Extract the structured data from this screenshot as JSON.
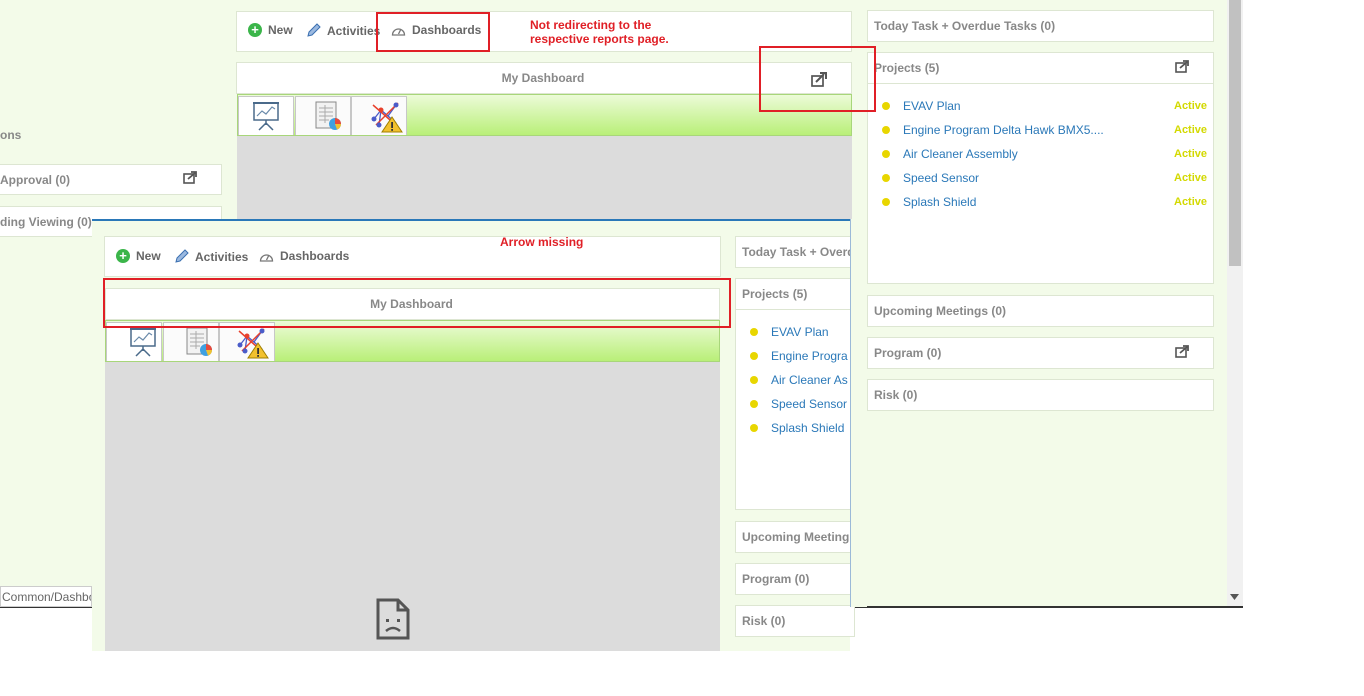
{
  "toolbar": {
    "new_label": "New",
    "activities_label": "Activities",
    "dashboards_label": "Dashboards"
  },
  "dashboard": {
    "title": "My Dashboard"
  },
  "annotations": {
    "redirect_note_line1": "Not redirecting to the",
    "redirect_note_line2": "respective reports page.",
    "arrow_note": "Arrow missing"
  },
  "right_panel": {
    "today_tasks": "Today Task + Overdue Tasks (0)",
    "projects_title": "Projects (5)",
    "projects": [
      {
        "name": "EVAV Plan",
        "status": "Active"
      },
      {
        "name": "Engine Program Delta Hawk BMX5....",
        "status": "Active"
      },
      {
        "name": "Air Cleaner Assembly",
        "status": "Active"
      },
      {
        "name": "Speed Sensor",
        "status": "Active"
      },
      {
        "name": "Splash Shield",
        "status": "Active"
      }
    ],
    "upcoming_meetings": "Upcoming Meetings (0)",
    "program": "Program (0)",
    "risk": "Risk (0)"
  },
  "left_panel": {
    "section_fragment": "ons",
    "approval": "Approval (0)",
    "pending_viewing": "ding Viewing (0)",
    "url_fragment": "Common/Dashbo"
  },
  "inset": {
    "today_tasks_partial": "Today Task + Overd",
    "projects_title": "Projects (5)",
    "projects": [
      "EVAV Plan",
      "Engine Progra",
      "Air Cleaner As",
      "Speed Sensor",
      "Splash Shield"
    ],
    "upcoming_partial": "Upcoming Meeting",
    "program": "Program (0)",
    "risk": "Risk (0)"
  },
  "colors": {
    "accent_green": "#3bb54a",
    "annotation_red": "#e01f26",
    "link_blue": "#2a78b8",
    "status_yellow": "#d3d900"
  },
  "icons": [
    "plus-circle-icon",
    "pencil-icon",
    "speedometer-icon",
    "export-icon",
    "presentation-chart-icon",
    "spreadsheet-pie-icon",
    "network-warning-icon",
    "broken-file-icon",
    "scroll-down-arrow-icon"
  ]
}
